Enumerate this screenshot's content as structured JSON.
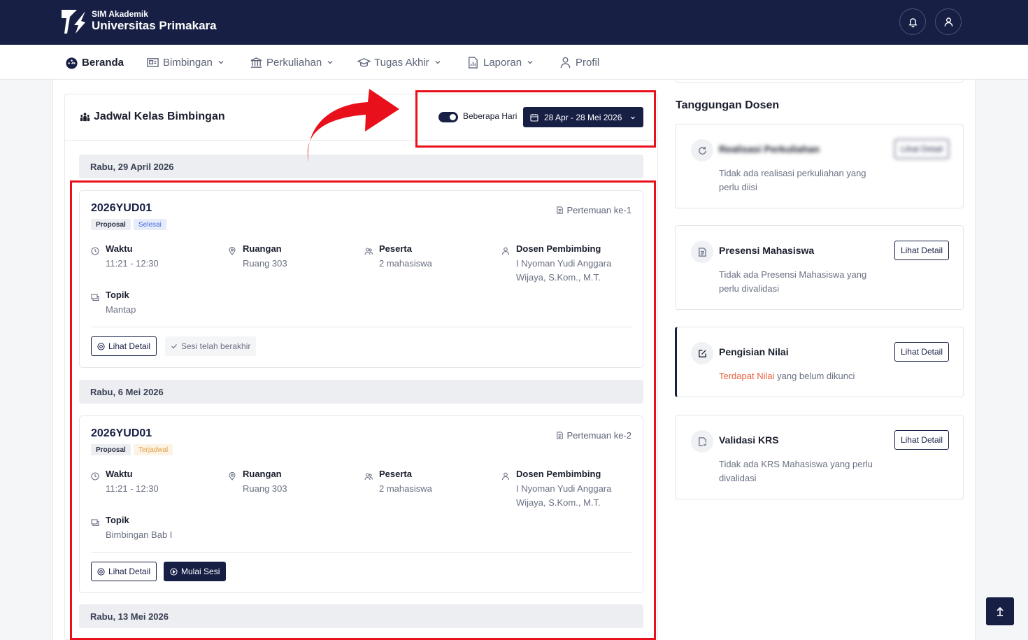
{
  "header": {
    "sub_title": "SIM Akademik",
    "title": "Universitas Primakara",
    "notification_icon": "bell-icon",
    "profile_icon": "user-icon"
  },
  "nav": {
    "items": [
      {
        "label": "Beranda",
        "icon": "dashboard-icon",
        "active": true
      },
      {
        "label": "Bimbingan",
        "icon": "presentation-icon"
      },
      {
        "label": "Perkuliahan",
        "icon": "building-icon"
      },
      {
        "label": "Tugas Akhir",
        "icon": "graduation-cap-icon"
      },
      {
        "label": "Laporan",
        "icon": "report-icon"
      },
      {
        "label": "Profil",
        "icon": "user-icon"
      }
    ]
  },
  "schedule": {
    "title": "Jadwal Kelas Bimbingan",
    "toggle_label": "Beberapa Hari",
    "toggle_on": true,
    "date_range": "28 Apr - 28 Mei 2026",
    "days": [
      {
        "date": "Rabu, 29 April 2026",
        "sessions": [
          {
            "code": "2026YUD01",
            "type": "Proposal",
            "status": "Selesai",
            "meeting": "Pertemuan ke-1",
            "waktu_label": "Waktu",
            "waktu": "11:21 - 12:30",
            "ruangan_label": "Ruangan",
            "ruangan": "Ruang 303",
            "peserta_label": "Peserta",
            "peserta": "2 mahasiswa",
            "dosen_label": "Dosen Pembimbing",
            "dosen_line1": "I Nyoman Yudi Anggara",
            "dosen_line2": "Wijaya, S.Kom., M.T.",
            "topik_label": "Topik",
            "topik": "Mantap",
            "detail_button": "Lihat Detail",
            "session_status": "Sesi telah berakhir"
          }
        ]
      },
      {
        "date": "Rabu, 6 Mei 2026",
        "sessions": [
          {
            "code": "2026YUD01",
            "type": "Proposal",
            "status": "Terjadwal",
            "meeting": "Pertemuan ke-2",
            "waktu_label": "Waktu",
            "waktu": "11:21 - 12:30",
            "ruangan_label": "Ruangan",
            "ruangan": "Ruang 303",
            "peserta_label": "Peserta",
            "peserta": "2 mahasiswa",
            "dosen_label": "Dosen Pembimbing",
            "dosen_line1": "I Nyoman Yudi Anggara",
            "dosen_line2": "Wijaya, S.Kom., M.T.",
            "topik_label": "Topik",
            "topik": "Bimbingan Bab I",
            "detail_button": "Lihat Detail",
            "start_button": "Mulai Sesi"
          }
        ]
      },
      {
        "date": "Rabu, 13 Mei 2026",
        "sessions": []
      }
    ]
  },
  "tanggungan": {
    "title": "Tanggungan Dosen",
    "items": [
      {
        "title": "Realisasi Perkuliahan",
        "desc": "Tidak ada realisasi perkuliahan yang perlu diisi",
        "button": "Lihat Detail",
        "icon": "refresh-icon"
      },
      {
        "title": "Presensi Mahasiswa",
        "desc": "Tidak ada Presensi Mahasiswa yang perlu divalidasi",
        "button": "Lihat Detail",
        "icon": "document-list-icon"
      },
      {
        "title": "Pengisian Nilai",
        "desc_highlight": "Terdapat Nilai",
        "desc_rest": " yang belum dikunci",
        "button": "Lihat Detail",
        "icon": "edit-square-icon"
      },
      {
        "title": "Validasi KRS",
        "desc": "Tidak ada KRS Mahasiswa yang perlu divalidasi",
        "button": "Lihat Detail",
        "icon": "file-check-icon"
      }
    ]
  },
  "scroll_top_icon": "arrow-up-icon",
  "colors": {
    "primary": "#171f45",
    "annotation_red": "#e8111b",
    "badge_selesai": "#4b6adf",
    "badge_terjadwal": "#e0a24a",
    "highlight": "#e8613f"
  }
}
